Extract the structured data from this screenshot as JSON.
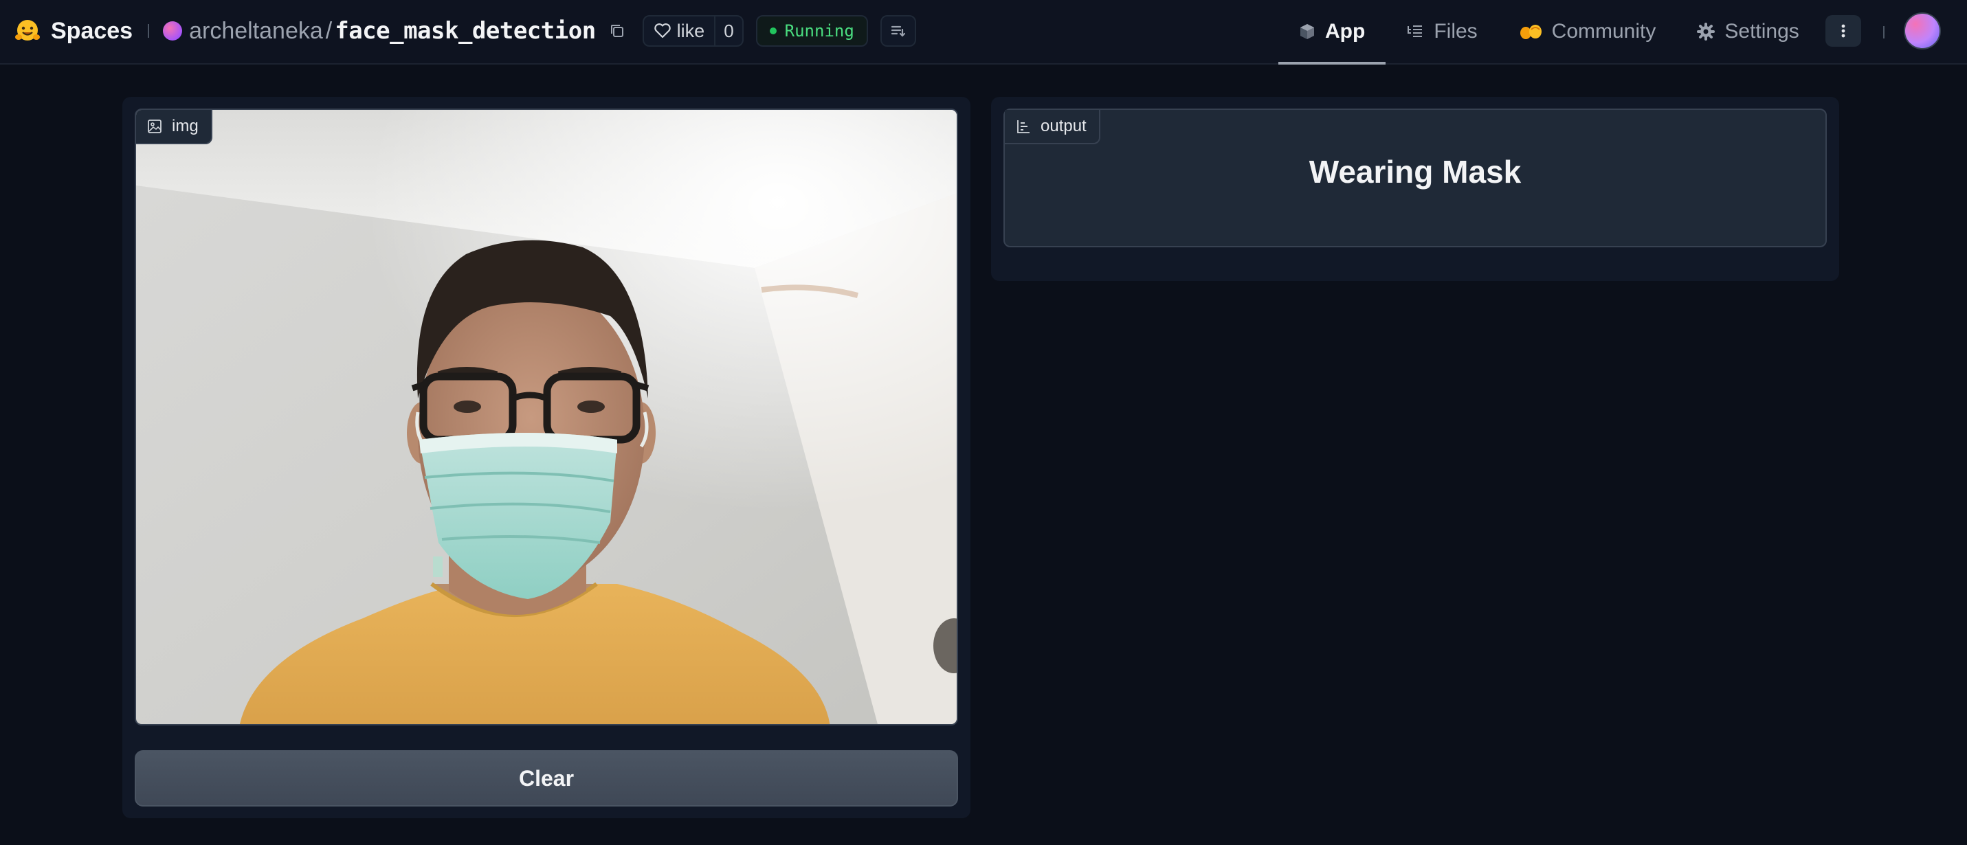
{
  "header": {
    "brand": "Spaces",
    "owner": "archeltaneka",
    "separator": "/",
    "repo": "face_mask_detection",
    "like_label": "like",
    "like_count": "0",
    "status": "Running",
    "nav": [
      {
        "label": "App",
        "icon": "cube-icon",
        "active": true
      },
      {
        "label": "Files",
        "icon": "files-icon",
        "active": false
      },
      {
        "label": "Community",
        "icon": "community-icon",
        "active": false
      },
      {
        "label": "Settings",
        "icon": "gear-icon",
        "active": false
      }
    ]
  },
  "input": {
    "label": "img",
    "clear_label": "Clear"
  },
  "output": {
    "label": "output",
    "value": "Wearing Mask"
  },
  "colors": {
    "background": "#0b0f19",
    "panel": "#111827",
    "status_green": "#4ade80",
    "button": "#4b5563"
  }
}
